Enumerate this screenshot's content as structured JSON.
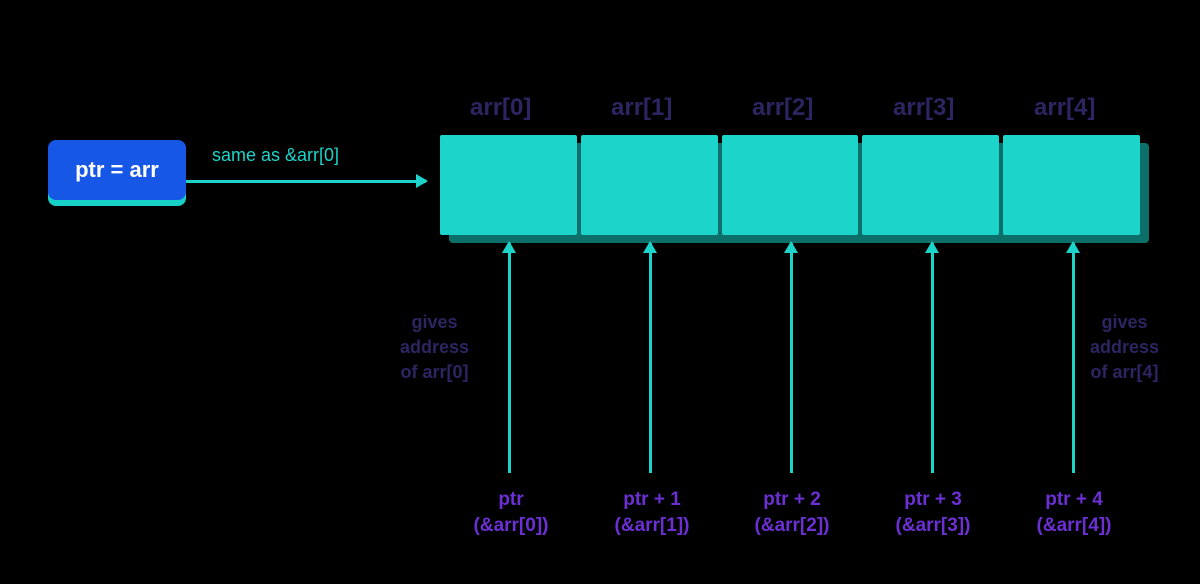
{
  "ptr_box": {
    "label": "ptr = arr"
  },
  "same_as": "same as &arr[0]",
  "indices": {
    "0": "arr[0]",
    "1": "arr[1]",
    "2": "arr[2]",
    "3": "arr[3]",
    "4": "arr[4]"
  },
  "gives": {
    "left": "gives\naddress\nof arr[0]",
    "right": "gives\naddress\nof arr[4]"
  },
  "pointers": {
    "0": {
      "expr": "ptr",
      "addr": "(&arr[0])"
    },
    "1": {
      "expr": "ptr + 1",
      "addr": "(&arr[1])"
    },
    "2": {
      "expr": "ptr + 2",
      "addr": "(&arr[2])"
    },
    "3": {
      "expr": "ptr + 3",
      "addr": "(&arr[3])"
    },
    "4": {
      "expr": "ptr + 4",
      "addr": "(&arr[4])"
    }
  }
}
